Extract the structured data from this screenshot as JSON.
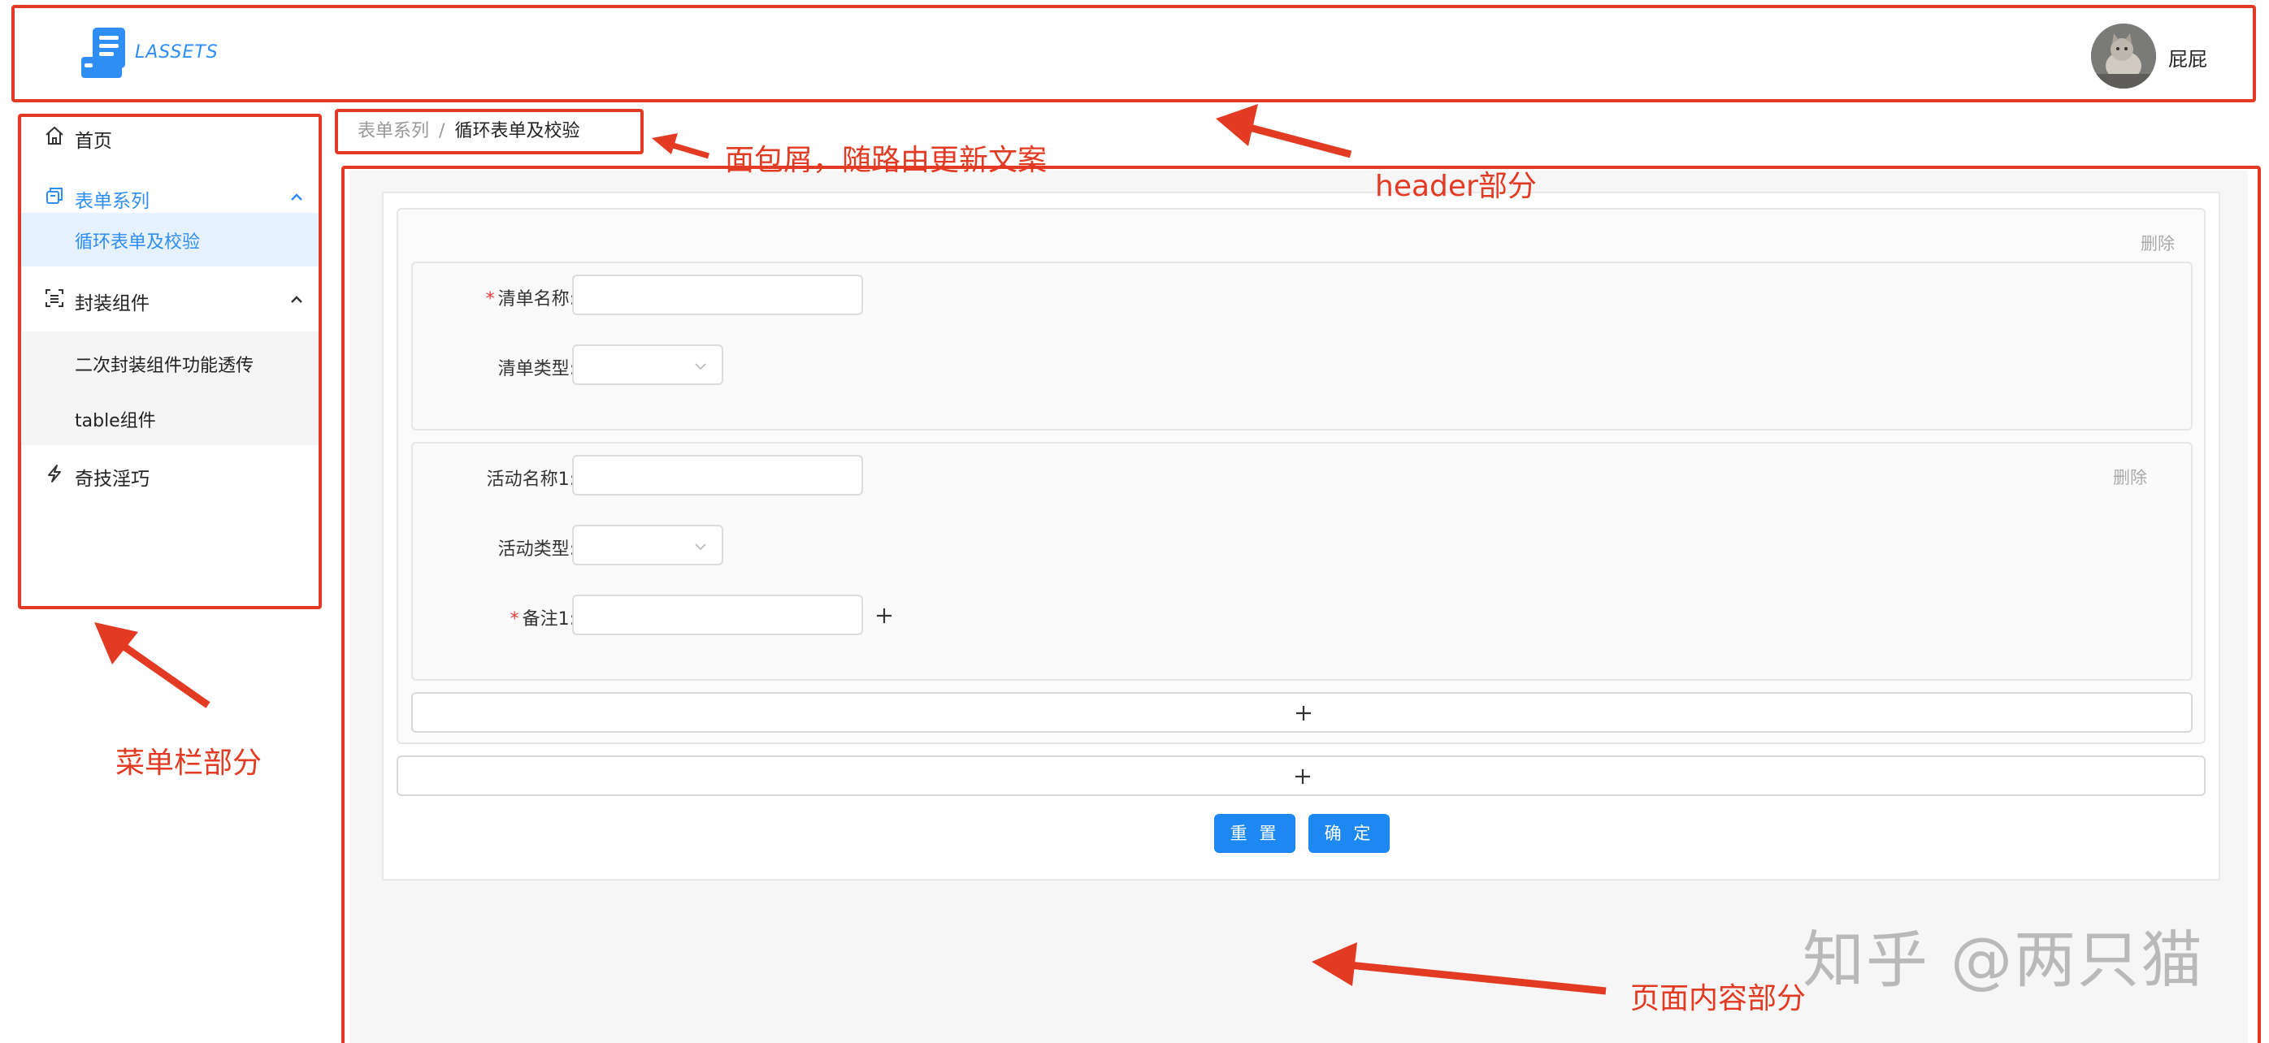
{
  "header": {
    "logo_text": "LASSETS",
    "user_name": "屁屁",
    "brand_color": "#2f8ef4"
  },
  "sidebar": {
    "items": [
      {
        "label": "首页",
        "icon": "home-icon"
      },
      {
        "label": "表单系列",
        "icon": "form-icon",
        "expanded": true,
        "children": [
          {
            "label": "循环表单及校验",
            "selected": true
          }
        ]
      },
      {
        "label": "封装组件",
        "icon": "component-icon",
        "expanded": true,
        "children": [
          {
            "label": "二次封装组件功能透传"
          },
          {
            "label": "table组件"
          }
        ]
      },
      {
        "label": "奇技淫巧",
        "icon": "lightning-icon"
      }
    ]
  },
  "breadcrumb": {
    "items": [
      "表单系列",
      "循环表单及校验"
    ],
    "separator": "/"
  },
  "form": {
    "sections": [
      {
        "delete_label": "删除",
        "fields": [
          {
            "label": "清单名称:",
            "required": true,
            "type": "input",
            "value": ""
          },
          {
            "label": "清单类型:",
            "required": false,
            "type": "select",
            "value": ""
          }
        ]
      },
      {
        "delete_label": "删除",
        "fields": [
          {
            "label": "活动名称1:",
            "required": false,
            "type": "input",
            "value": ""
          },
          {
            "label": "活动类型:",
            "required": false,
            "type": "select",
            "value": ""
          },
          {
            "label": "备注1:",
            "required": true,
            "type": "input",
            "value": ""
          }
        ]
      }
    ],
    "reset_label": "重 置",
    "confirm_label": "确 定"
  },
  "annotations": {
    "breadcrumb_note": "面包屑，随路由更新文案",
    "header_note": "header部分",
    "menu_note": "菜单栏部分",
    "content_note": "页面内容部分",
    "color": "#e23a23"
  },
  "watermark": "知乎 @两只猫"
}
